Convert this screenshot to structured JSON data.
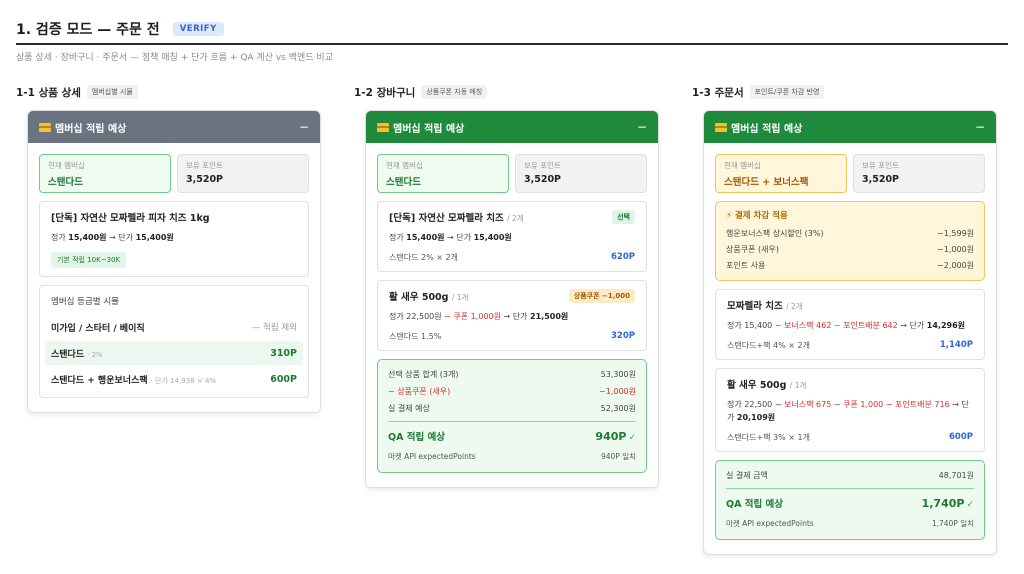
{
  "header": {
    "title": "1. 검증 모드 — 주문 전",
    "badge": "VERIFY",
    "subtitle": "상품 상세 · 장바구니 · 주문서 — 정책 매칭 + 단가 흐름 + QA 계산 vs 백엔드 비교"
  },
  "col1": {
    "title": "1-1 상품 상세",
    "tag": "멤버십별 시뮬",
    "card_title": "멤버십 적립 예상",
    "membership_label": "현재 멤버십",
    "membership_value": "스탠다드",
    "points_label": "보유 포인트",
    "points_value": "3,520P",
    "product": {
      "name": "[단독] 자연산 모짜렐라 피자 치즈 1kg",
      "price_prefix": "정가 ",
      "price": "15,400원",
      "arrow": " → 단가 ",
      "unit_price": "15,400원",
      "basic_badge": "기본 적립 10K~30K"
    },
    "sim": {
      "title": "멤버십 등급별 시뮬",
      "rows": [
        {
          "name": "미가입 / 스타터 / 베이직",
          "note": "",
          "value": "— 적립 제외"
        },
        {
          "name": "스탠다드",
          "note": "· 2%",
          "value": "310P"
        },
        {
          "name": "스탠다드 + 행운보너스팩",
          "note": "· 단가 14,938 × 4%",
          "value": "600P"
        }
      ]
    }
  },
  "col2": {
    "title": "1-2 장바구니",
    "tag": "상품쿠폰 자동 매칭",
    "card_title": "멤버십 적립 예상",
    "membership_label": "현재 멤버십",
    "membership_value": "스탠다드",
    "points_label": "보유 포인트",
    "points_value": "3,520P",
    "items": [
      {
        "name": "[단독] 자연산 모짜렐라 치즈",
        "qty": "/ 2개",
        "badge": "선택",
        "price_prefix": "정가 ",
        "price": "15,400원",
        "arrow": " → 단가 ",
        "unit_price": "15,400원",
        "calc": "스탠다드 2% × 2개",
        "points": "620P"
      },
      {
        "name": "활 새우 500g",
        "qty": "/ 1개",
        "badge": "상품쿠폰 −1,000",
        "price_prefix": "정가 22,500원 ",
        "coupon": "− 쿠폰 1,000원",
        "arrow": " → 단가 ",
        "unit_price": "21,500원",
        "calc": "스탠다드 1.5%",
        "points": "320P"
      }
    ],
    "summary": {
      "rows": [
        {
          "label": "선택 상품 합계 (3개)",
          "value": "53,300원"
        },
        {
          "label": "− 상품쿠폰 (새우)",
          "value": "−1,000원"
        },
        {
          "label": "실 결제 예상",
          "value": "52,300원"
        }
      ],
      "qa_label": "QA 적립 예상",
      "qa_value": "940P",
      "check": "✓",
      "api_label": "마켓 API expectedPoints",
      "api_value": "940P 일치"
    }
  },
  "col3": {
    "title": "1-3 주문서",
    "tag": "포인트/쿠폰 차감 반영",
    "card_title": "멤버십 적립 예상",
    "membership_label": "현재 멤버십",
    "membership_value": "스탠다드 + 보너스팩",
    "points_label": "보유 포인트",
    "points_value": "3,520P",
    "deduct": {
      "title": "결제 차감 적용",
      "rows": [
        {
          "label": "행운보너스팩 상시할인 (3%)",
          "value": "−1,599원"
        },
        {
          "label": "상품쿠폰 (새우)",
          "value": "−1,000원"
        },
        {
          "label": "포인트 사용",
          "value": "−2,000원"
        }
      ]
    },
    "items": [
      {
        "name": "모짜렐라 치즈",
        "qty": "/ 2개",
        "l1": "정가 15,400 ",
        "l2": "− 보너스팩 462 − 포인트배분 642",
        "l3": " → 단가 ",
        "l4": "14,296원",
        "calc": "스탠다드+팩 4% × 2개",
        "points": "1,140P"
      },
      {
        "name": "활 새우 500g",
        "qty": "/ 1개",
        "l1": "정가 22,500 ",
        "l2": "− 보너스팩 675 − 쿠폰 1,000 − 포인트배분 716",
        "l3": " → 단가 ",
        "l4": "20,109원",
        "calc": "스탠다드+팩 3% × 1개",
        "points": "600P"
      }
    ],
    "summary": {
      "pay_label": "실 결제 금액",
      "pay_value": "48,701원",
      "qa_label": "QA 적립 예상",
      "qa_value": "1,740P",
      "check": "✓",
      "api_label": "마켓 API expectedPoints",
      "api_value": "1,740P 일치"
    }
  }
}
